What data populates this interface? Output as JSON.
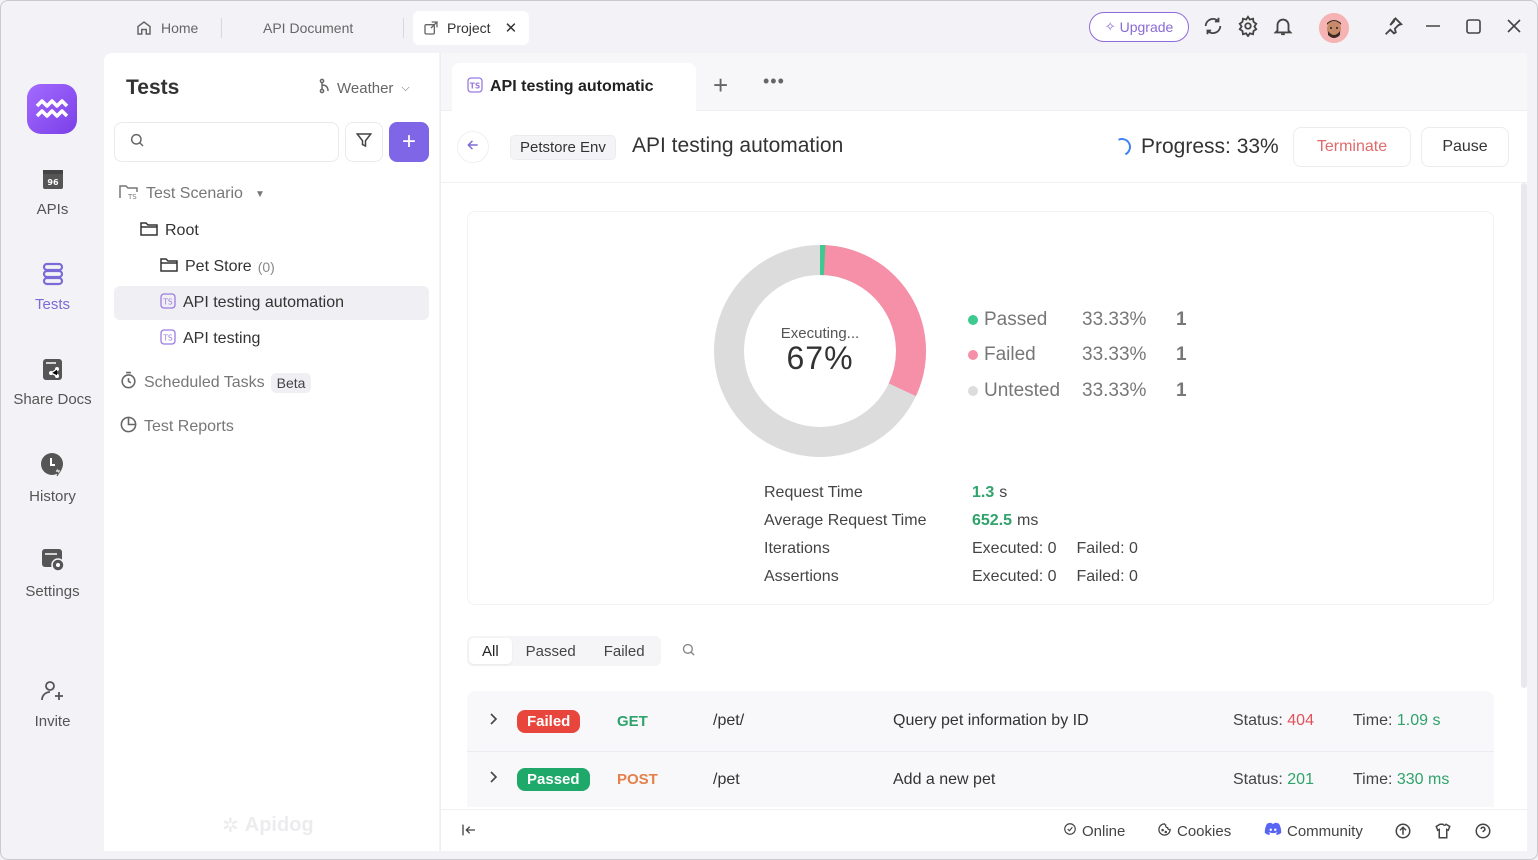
{
  "topbar": {
    "tabs": [
      {
        "label": "Home",
        "icon": "home-icon"
      },
      {
        "label": "API Document"
      },
      {
        "label": "Project",
        "icon": "external-link-icon",
        "active": true
      }
    ],
    "upgrade_label": "Upgrade",
    "icons": [
      "refresh-icon",
      "gear-icon",
      "bell-icon",
      "avatar",
      "pin-icon",
      "minimize-icon",
      "maximize-icon",
      "close-icon"
    ]
  },
  "rail": {
    "items": [
      {
        "label": "APIs",
        "icon": "api-icon"
      },
      {
        "label": "Tests",
        "icon": "tests-icon",
        "active": true
      },
      {
        "label": "Share Docs",
        "icon": "share-docs-icon"
      },
      {
        "label": "History",
        "icon": "history-icon"
      },
      {
        "label": "Settings",
        "icon": "settings-icon"
      },
      {
        "label": "Invite",
        "icon": "invite-icon"
      }
    ]
  },
  "panel": {
    "title": "Tests",
    "branch": "Weather",
    "search": {
      "value": "",
      "placeholder": ""
    },
    "tree": {
      "scenario_label": "Test Scenario",
      "root_label": "Root",
      "pet_store_label": "Pet Store",
      "pet_store_count": "(0)",
      "items": [
        "API testing automation",
        "API testing"
      ],
      "scheduled_label": "Scheduled Tasks",
      "beta_label": "Beta",
      "reports_label": "Test Reports"
    },
    "watermark": "Apidog"
  },
  "main": {
    "doc_tab_label": "API testing automatic",
    "env_label": "Petstore Env",
    "title": "API testing automation",
    "progress_label": "Progress: 33%",
    "progress_value": 33,
    "terminate_label": "Terminate",
    "pause_label": "Pause",
    "summary": {
      "executing_label": "Executing...",
      "executing_pct": "67%",
      "legend": [
        {
          "name": "Passed",
          "pct": "33.33%",
          "count": "1",
          "color": "#3ec98f"
        },
        {
          "name": "Failed",
          "pct": "33.33%",
          "count": "1",
          "color": "#f68fa8"
        },
        {
          "name": "Untested",
          "pct": "33.33%",
          "count": "1",
          "color": "#dcdcdc"
        }
      ],
      "stats": {
        "request_time_label": "Request Time",
        "request_time_value": "1.3",
        "request_time_unit": "s",
        "avg_time_label": "Average Request Time",
        "avg_time_value": "652.5",
        "avg_time_unit": "ms",
        "iterations_label": "Iterations",
        "iterations_executed": "Executed: 0",
        "iterations_failed": "Failed: 0",
        "assertions_label": "Assertions",
        "assertions_executed": "Executed: 0",
        "assertions_failed": "Failed: 0"
      }
    },
    "filter_tabs": [
      "All",
      "Passed",
      "Failed"
    ],
    "results": [
      {
        "status": "Failed",
        "status_color": "#e8453c",
        "method": "GET",
        "method_color": "#2fa36b",
        "path": "/pet/",
        "desc": "Query pet information by ID",
        "status_label": "Status:",
        "code": "404",
        "code_color": "#e0525a",
        "time_label": "Time:",
        "time": "1.09 s"
      },
      {
        "status": "Passed",
        "status_color": "#1ea86a",
        "method": "POST",
        "method_color": "#e2814a",
        "path": "/pet",
        "desc": "Add a new pet",
        "status_label": "Status:",
        "code": "201",
        "code_color": "#2fa36b",
        "time_label": "Time:",
        "time": "330 ms"
      }
    ],
    "footer": {
      "online": "Online",
      "cookies": "Cookies",
      "community": "Community"
    }
  },
  "colors": {
    "accent": "#7f66e6",
    "passed": "#3ec98f",
    "failed": "#f68fa8",
    "untested": "#dcdcdc"
  }
}
